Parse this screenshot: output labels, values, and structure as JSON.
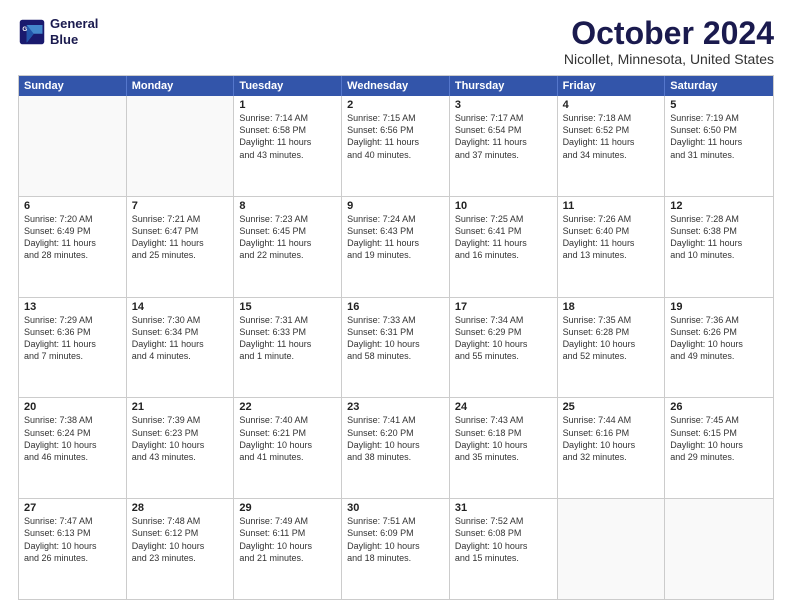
{
  "logo": {
    "line1": "General",
    "line2": "Blue"
  },
  "title": "October 2024",
  "location": "Nicollet, Minnesota, United States",
  "header_days": [
    "Sunday",
    "Monday",
    "Tuesday",
    "Wednesday",
    "Thursday",
    "Friday",
    "Saturday"
  ],
  "rows": [
    [
      {
        "day": "",
        "info": ""
      },
      {
        "day": "",
        "info": ""
      },
      {
        "day": "1",
        "info": "Sunrise: 7:14 AM\nSunset: 6:58 PM\nDaylight: 11 hours\nand 43 minutes."
      },
      {
        "day": "2",
        "info": "Sunrise: 7:15 AM\nSunset: 6:56 PM\nDaylight: 11 hours\nand 40 minutes."
      },
      {
        "day": "3",
        "info": "Sunrise: 7:17 AM\nSunset: 6:54 PM\nDaylight: 11 hours\nand 37 minutes."
      },
      {
        "day": "4",
        "info": "Sunrise: 7:18 AM\nSunset: 6:52 PM\nDaylight: 11 hours\nand 34 minutes."
      },
      {
        "day": "5",
        "info": "Sunrise: 7:19 AM\nSunset: 6:50 PM\nDaylight: 11 hours\nand 31 minutes."
      }
    ],
    [
      {
        "day": "6",
        "info": "Sunrise: 7:20 AM\nSunset: 6:49 PM\nDaylight: 11 hours\nand 28 minutes."
      },
      {
        "day": "7",
        "info": "Sunrise: 7:21 AM\nSunset: 6:47 PM\nDaylight: 11 hours\nand 25 minutes."
      },
      {
        "day": "8",
        "info": "Sunrise: 7:23 AM\nSunset: 6:45 PM\nDaylight: 11 hours\nand 22 minutes."
      },
      {
        "day": "9",
        "info": "Sunrise: 7:24 AM\nSunset: 6:43 PM\nDaylight: 11 hours\nand 19 minutes."
      },
      {
        "day": "10",
        "info": "Sunrise: 7:25 AM\nSunset: 6:41 PM\nDaylight: 11 hours\nand 16 minutes."
      },
      {
        "day": "11",
        "info": "Sunrise: 7:26 AM\nSunset: 6:40 PM\nDaylight: 11 hours\nand 13 minutes."
      },
      {
        "day": "12",
        "info": "Sunrise: 7:28 AM\nSunset: 6:38 PM\nDaylight: 11 hours\nand 10 minutes."
      }
    ],
    [
      {
        "day": "13",
        "info": "Sunrise: 7:29 AM\nSunset: 6:36 PM\nDaylight: 11 hours\nand 7 minutes."
      },
      {
        "day": "14",
        "info": "Sunrise: 7:30 AM\nSunset: 6:34 PM\nDaylight: 11 hours\nand 4 minutes."
      },
      {
        "day": "15",
        "info": "Sunrise: 7:31 AM\nSunset: 6:33 PM\nDaylight: 11 hours\nand 1 minute."
      },
      {
        "day": "16",
        "info": "Sunrise: 7:33 AM\nSunset: 6:31 PM\nDaylight: 10 hours\nand 58 minutes."
      },
      {
        "day": "17",
        "info": "Sunrise: 7:34 AM\nSunset: 6:29 PM\nDaylight: 10 hours\nand 55 minutes."
      },
      {
        "day": "18",
        "info": "Sunrise: 7:35 AM\nSunset: 6:28 PM\nDaylight: 10 hours\nand 52 minutes."
      },
      {
        "day": "19",
        "info": "Sunrise: 7:36 AM\nSunset: 6:26 PM\nDaylight: 10 hours\nand 49 minutes."
      }
    ],
    [
      {
        "day": "20",
        "info": "Sunrise: 7:38 AM\nSunset: 6:24 PM\nDaylight: 10 hours\nand 46 minutes."
      },
      {
        "day": "21",
        "info": "Sunrise: 7:39 AM\nSunset: 6:23 PM\nDaylight: 10 hours\nand 43 minutes."
      },
      {
        "day": "22",
        "info": "Sunrise: 7:40 AM\nSunset: 6:21 PM\nDaylight: 10 hours\nand 41 minutes."
      },
      {
        "day": "23",
        "info": "Sunrise: 7:41 AM\nSunset: 6:20 PM\nDaylight: 10 hours\nand 38 minutes."
      },
      {
        "day": "24",
        "info": "Sunrise: 7:43 AM\nSunset: 6:18 PM\nDaylight: 10 hours\nand 35 minutes."
      },
      {
        "day": "25",
        "info": "Sunrise: 7:44 AM\nSunset: 6:16 PM\nDaylight: 10 hours\nand 32 minutes."
      },
      {
        "day": "26",
        "info": "Sunrise: 7:45 AM\nSunset: 6:15 PM\nDaylight: 10 hours\nand 29 minutes."
      }
    ],
    [
      {
        "day": "27",
        "info": "Sunrise: 7:47 AM\nSunset: 6:13 PM\nDaylight: 10 hours\nand 26 minutes."
      },
      {
        "day": "28",
        "info": "Sunrise: 7:48 AM\nSunset: 6:12 PM\nDaylight: 10 hours\nand 23 minutes."
      },
      {
        "day": "29",
        "info": "Sunrise: 7:49 AM\nSunset: 6:11 PM\nDaylight: 10 hours\nand 21 minutes."
      },
      {
        "day": "30",
        "info": "Sunrise: 7:51 AM\nSunset: 6:09 PM\nDaylight: 10 hours\nand 18 minutes."
      },
      {
        "day": "31",
        "info": "Sunrise: 7:52 AM\nSunset: 6:08 PM\nDaylight: 10 hours\nand 15 minutes."
      },
      {
        "day": "",
        "info": ""
      },
      {
        "day": "",
        "info": ""
      }
    ]
  ]
}
